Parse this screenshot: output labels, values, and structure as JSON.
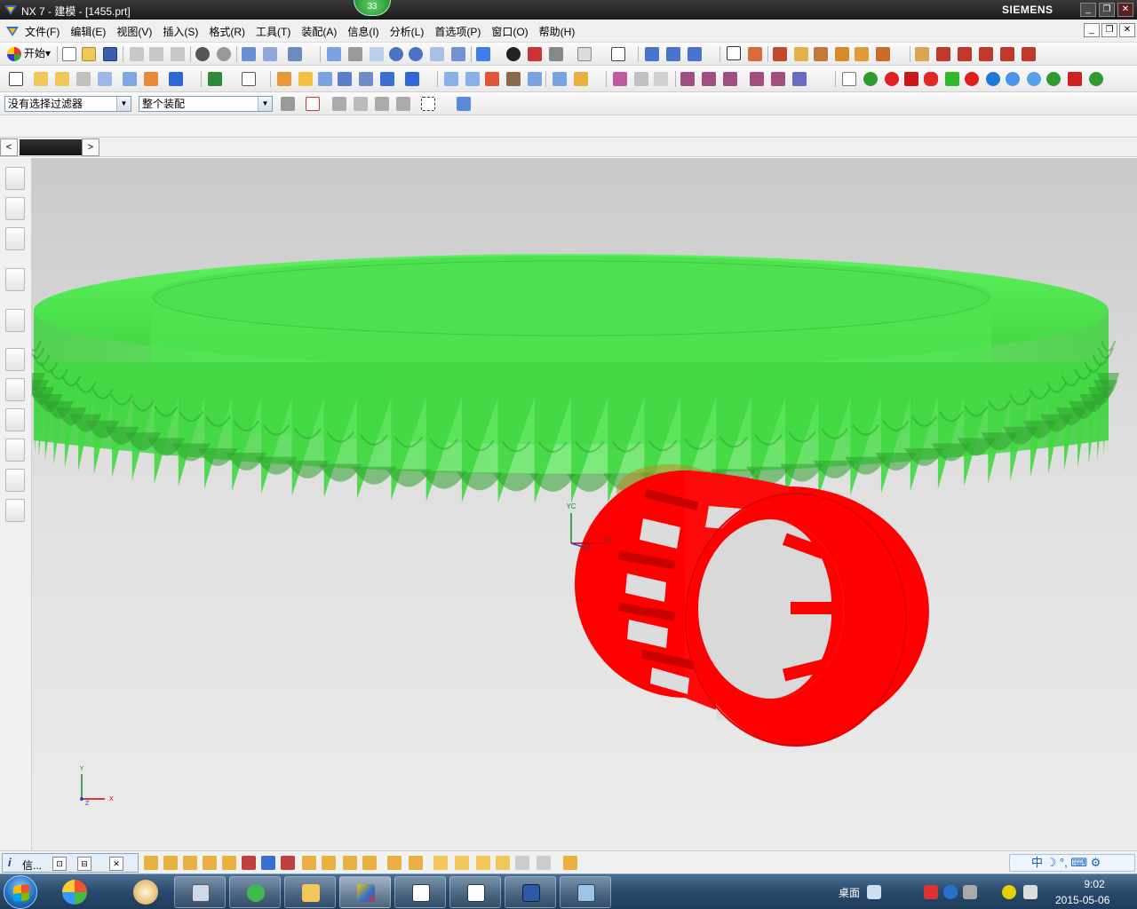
{
  "window": {
    "title": "NX 7 - 建模 - [1455.prt]",
    "badge": "33",
    "brand": "SIEMENS",
    "controls": [
      "_",
      "❐",
      "✕"
    ]
  },
  "menu": {
    "items": [
      "文件(F)",
      "编辑(E)",
      "视图(V)",
      "插入(S)",
      "格式(R)",
      "工具(T)",
      "装配(A)",
      "信息(I)",
      "分析(L)",
      "首选项(P)",
      "窗口(O)",
      "帮助(H)"
    ],
    "mdi_controls": [
      "_",
      "❐",
      "✕"
    ]
  },
  "toolbar": {
    "start_label": "开始",
    "start_arrow": "▾"
  },
  "selection": {
    "filter_value": "没有选择过滤器",
    "scope_value": "整个装配",
    "arrow": "▼"
  },
  "tabs": {
    "prev": "<",
    "next": ">"
  },
  "viewport": {
    "wcs_labels": {
      "yc": "YC",
      "xc": "XC",
      "zc": "ZC"
    },
    "abs_labels": {
      "y": "Y",
      "x": "X",
      "z": "Z"
    },
    "gear_color": "#4ee84e",
    "bearing_color": "#ff0000",
    "bearing_shadow": "#c40000"
  },
  "infobar": {
    "i_icon": "i",
    "label": "信...",
    "buttons": [
      "⊡",
      "⊟",
      "✕"
    ]
  },
  "ime": {
    "text": "中 ☽ °, ⌨ ⚙"
  },
  "tray": {
    "desktop_label": "桌面",
    "time": "9:02",
    "date": "2015-05-06"
  }
}
